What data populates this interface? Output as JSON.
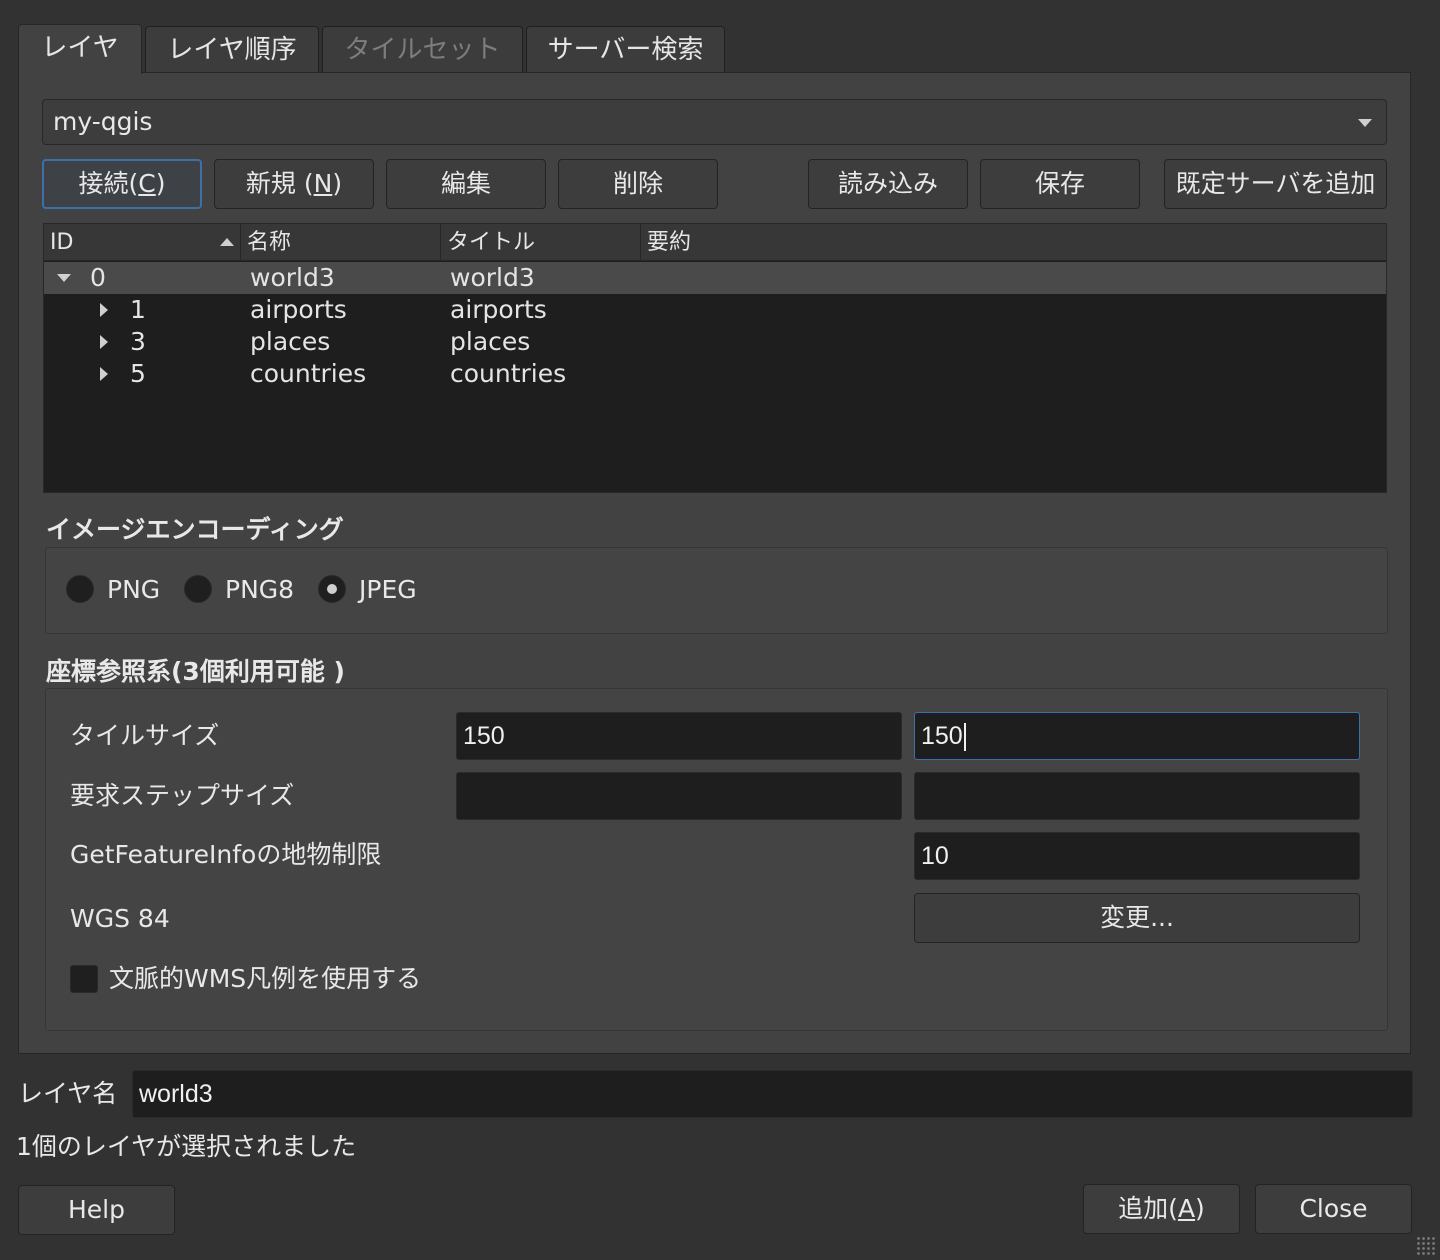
{
  "tabs": [
    {
      "label": "レイヤ",
      "state": "active"
    },
    {
      "label": "レイヤ順序",
      "state": "normal"
    },
    {
      "label": "タイルセット",
      "state": "disabled"
    },
    {
      "label": "サーバー検索",
      "state": "normal"
    }
  ],
  "connection": {
    "selected": "my-qgis"
  },
  "buttons": {
    "connect_prefix": "接続(",
    "connect_key": "C",
    "connect_suffix": ")",
    "new_prefix": "新規 (",
    "new_key": "N",
    "new_suffix": ")",
    "edit": "編集",
    "delete": "削除",
    "load": "読み込み",
    "save": "保存",
    "add_default": "既定サーバを追加"
  },
  "table": {
    "headers": [
      "ID",
      "名称",
      "タイトル",
      "要約"
    ],
    "rows": [
      {
        "id": "0",
        "name": "world3",
        "title": "world3",
        "expanded": true,
        "level": 0
      },
      {
        "id": "1",
        "name": "airports",
        "title": "airports",
        "expanded": false,
        "level": 1
      },
      {
        "id": "3",
        "name": "places",
        "title": "places",
        "expanded": false,
        "level": 1
      },
      {
        "id": "5",
        "name": "countries",
        "title": "countries",
        "expanded": false,
        "level": 1
      }
    ]
  },
  "encoding": {
    "title": "イメージエンコーディング",
    "options": [
      "PNG",
      "PNG8",
      "JPEG"
    ],
    "selected": "JPEG"
  },
  "crs": {
    "title": "座標参照系(3個利用可能 )",
    "tile_size_label": "タイルサイズ",
    "tile_width": "150",
    "tile_height": "150",
    "step_size_label": "要求ステップサイズ",
    "step_width": "",
    "step_height": "",
    "feature_limit_label": "GetFeatureInfoの地物制限",
    "feature_limit": "10",
    "crs_name": "WGS 84",
    "change_button": "変更...",
    "contextual_legend_label": "文脈的WMS凡例を使用する",
    "contextual_legend_checked": false
  },
  "layer_name": {
    "label": "レイヤ名",
    "value": "world3"
  },
  "status": "1個のレイヤが選択されました",
  "footer": {
    "help": "Help",
    "add_prefix": "追加(",
    "add_key": "A",
    "add_suffix": ")",
    "close": "Close"
  },
  "colors": {
    "background": "#323232",
    "panel": "#424242",
    "focus": "#3e6fa8",
    "field": "#1e1e1e"
  }
}
